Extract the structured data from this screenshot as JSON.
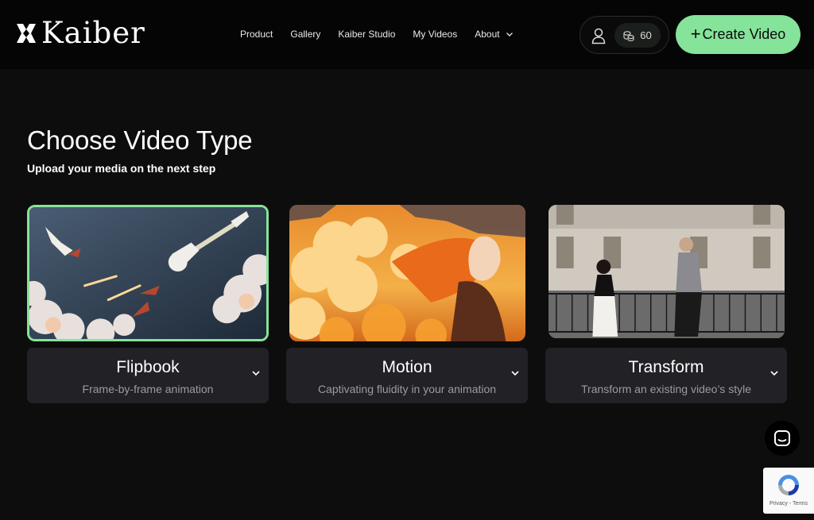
{
  "header": {
    "logo_text": "Kaiber",
    "nav": [
      {
        "label": "Product"
      },
      {
        "label": "Gallery"
      },
      {
        "label": "Kaiber Studio"
      },
      {
        "label": "My Videos"
      },
      {
        "label": "About"
      }
    ],
    "credits": "60",
    "create_label": "Create Video",
    "create_plus": "+"
  },
  "main": {
    "title": "Choose Video Type",
    "subtitle": "Upload your media on the next step",
    "cards": [
      {
        "title": "Flipbook",
        "description": "Frame-by-frame animation",
        "selected": true
      },
      {
        "title": "Motion",
        "description": "Captivating fluidity in your animation",
        "selected": false
      },
      {
        "title": "Transform",
        "description": "Transform an existing video’s style",
        "selected": false
      }
    ]
  },
  "recaptcha": {
    "text": "Privacy - Terms"
  },
  "colors": {
    "accent": "#86e39a",
    "background": "#0d0d0d",
    "card": "#212126"
  },
  "icons": [
    "kaiber-logo-icon",
    "user-icon",
    "coins-icon",
    "plus-icon",
    "chevron-down-icon",
    "chat-icon",
    "recaptcha-icon"
  ]
}
